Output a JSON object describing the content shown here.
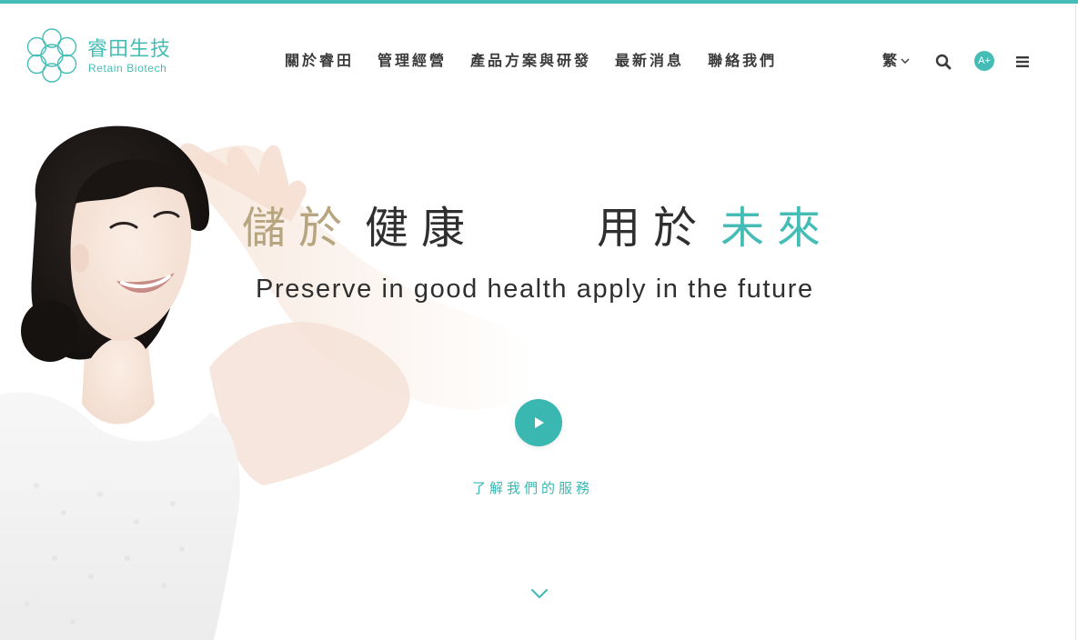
{
  "brand": {
    "name_cn": "睿田生技",
    "name_en": "Retain Biotech",
    "color": "#45bdb6"
  },
  "nav": {
    "items": [
      {
        "label": "關於睿田"
      },
      {
        "label": "管理經營"
      },
      {
        "label": "產品方案與研發"
      },
      {
        "label": "最新消息"
      },
      {
        "label": "聯絡我們"
      }
    ]
  },
  "utilities": {
    "language_label": "繁",
    "language_icon": "chevron-down-icon",
    "search_icon": "search-icon",
    "font_size_label": "A+",
    "menu_icon": "hamburger-menu-icon"
  },
  "hero": {
    "tagline_cn_part1": "儲於",
    "tagline_cn_part2": "健康",
    "tagline_cn_part3": "用於",
    "tagline_cn_part4": "未來",
    "tagline_en": "Preserve in good health apply in the future",
    "play_icon": "play-icon",
    "services_link": "了解我們的服務",
    "scroll_icon": "chevron-down-icon"
  },
  "colors": {
    "accent": "#45bdb6",
    "gold": "#b6a57e",
    "text": "#2f2f2f"
  }
}
